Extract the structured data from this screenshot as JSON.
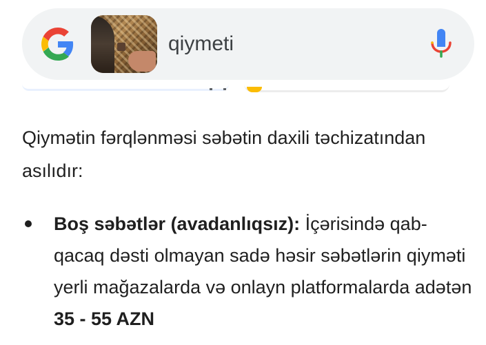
{
  "search": {
    "query": "qiymeti",
    "thumbnail_icon": "basket-image-thumbnail",
    "logo_icon": "google-g-icon",
    "mic_icon": "microphone-icon"
  },
  "content": {
    "intro": "Qiymətin fərqlənməsi səbətin daxili təchizatından asılıdır:",
    "bullets": [
      {
        "heading": "Boş səbətlər (avadanlıqsız):",
        "text_before": " İçərisində qab-qacaq dəsti olmayan sadə həsir səbətlərin qiyməti yerli mağazalarda və onlayn platformalarda adətən ",
        "price": "35 - 55 AZN"
      }
    ]
  },
  "colors": {
    "google_blue": "#4285f4",
    "google_red": "#ea4335",
    "google_yellow": "#fbbc04",
    "google_green": "#34a853",
    "search_bg": "#f1f3f4"
  }
}
